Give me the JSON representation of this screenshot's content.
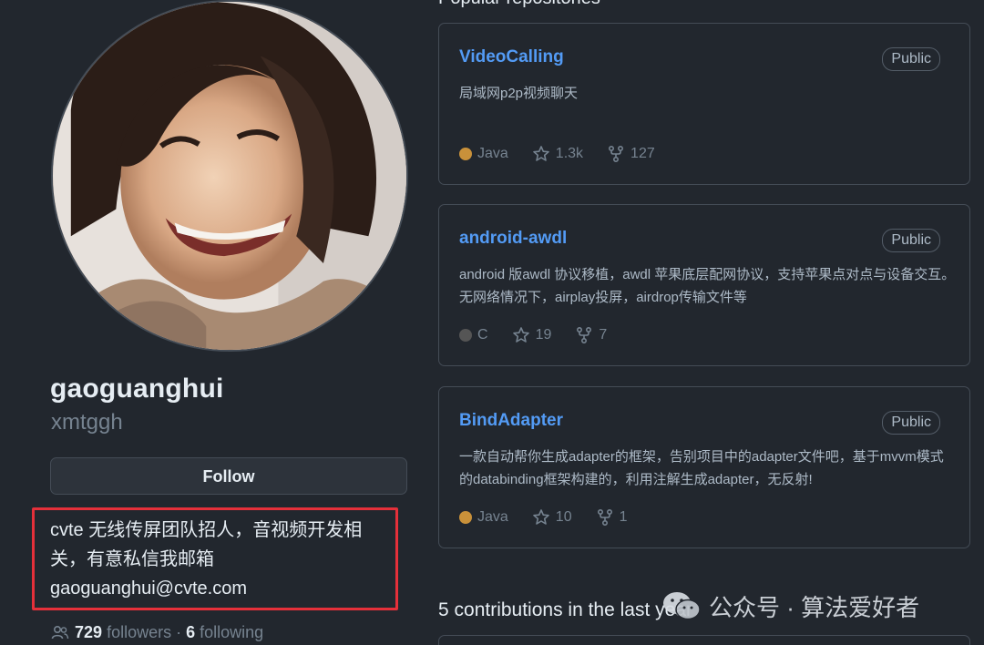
{
  "profile": {
    "name": "gaoguanghui",
    "login": "xmtggh",
    "follow_label": "Follow",
    "bio_line1": "cvte 无线传屏团队招人，音视频开发相",
    "bio_line2": "关，有意私信我邮箱",
    "email": "gaoguanghui@cvte.com",
    "followers_count": "729",
    "followers_label": "followers",
    "separator": "·",
    "following_count": "6",
    "following_label": "following"
  },
  "popular": {
    "title": "Popular repositories",
    "repos": [
      {
        "name": "VideoCalling",
        "visibility": "Public",
        "description": "局域网p2p视频聊天",
        "language": "Java",
        "language_color": "#c9913a",
        "stars": "1.3k",
        "forks": "127"
      },
      {
        "name": "android-awdl",
        "visibility": "Public",
        "description": "android 版awdl 协议移植，awdl 苹果底层配网协议，支持苹果点对点与设备交互。无网络情况下，airplay投屏，airdrop传输文件等",
        "language": "C",
        "language_color": "#555555",
        "stars": "19",
        "forks": "7"
      },
      {
        "name": "BindAdapter",
        "visibility": "Public",
        "description": "一款自动帮你生成adapter的框架，告别项目中的adapter文件吧，基于mvvm模式的databinding框架构建的，利用注解生成adapter，无反射!",
        "language": "Java",
        "language_color": "#c9913a",
        "stars": "10",
        "forks": "1"
      }
    ]
  },
  "contributions": {
    "title": "5 contributions in the last year"
  },
  "watermark": {
    "text": "公众号 · 算法爱好者",
    "icon": "wechat-icon"
  },
  "colors": {
    "background": "#22272e",
    "link": "#539bf5",
    "highlight_box": "#e5303a"
  }
}
